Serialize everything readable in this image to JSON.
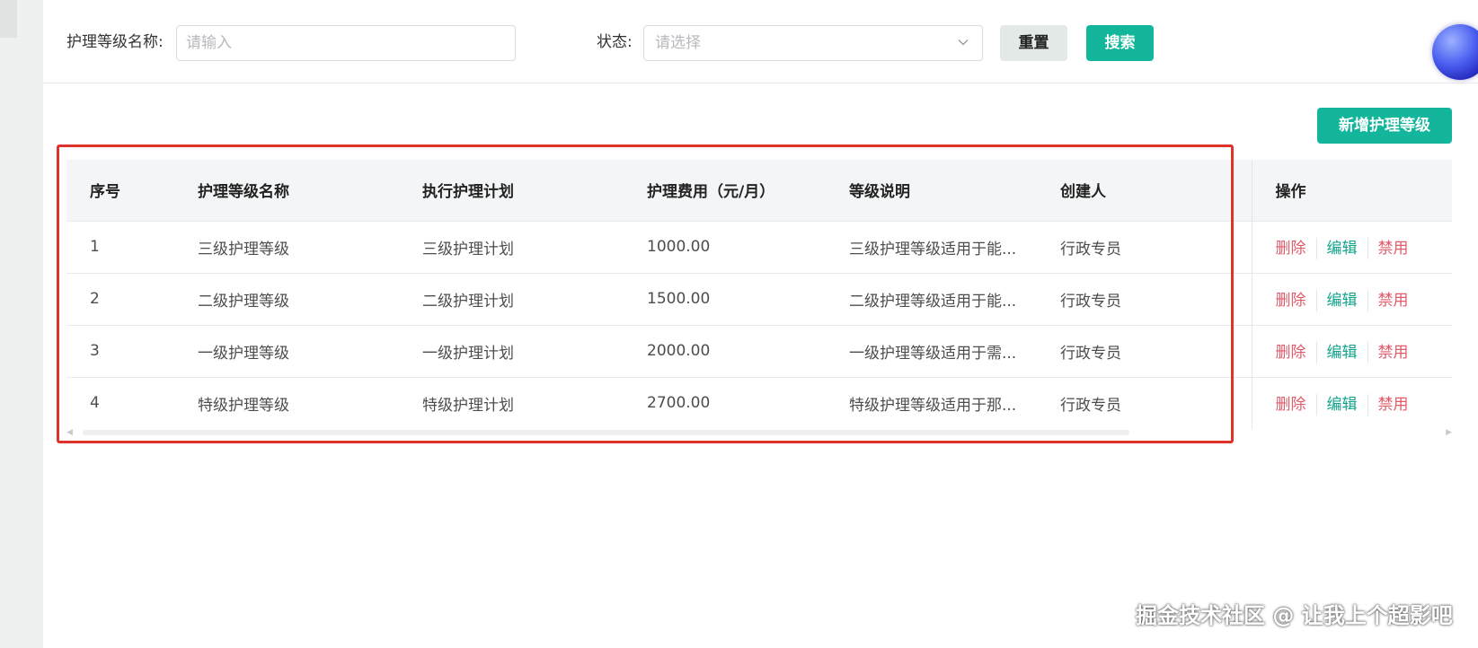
{
  "filter": {
    "name_label": "护理等级名称:",
    "name_placeholder": "请输入",
    "status_label": "状态:",
    "status_placeholder": "请选择",
    "reset_label": "重置",
    "search_label": "搜索"
  },
  "toolbar": {
    "add_label": "新增护理等级"
  },
  "table": {
    "columns": [
      "序号",
      "护理等级名称",
      "执行护理计划",
      "护理费用（元/月）",
      "等级说明",
      "创建人",
      "操作"
    ],
    "rows": [
      {
        "index": "1",
        "name": "三级护理等级",
        "plan": "三级护理计划",
        "fee": "1000.00",
        "desc": "三级护理等级适用于能...",
        "creator": "行政专员"
      },
      {
        "index": "2",
        "name": "二级护理等级",
        "plan": "二级护理计划",
        "fee": "1500.00",
        "desc": "二级护理等级适用于能...",
        "creator": "行政专员"
      },
      {
        "index": "3",
        "name": "一级护理等级",
        "plan": "一级护理计划",
        "fee": "2000.00",
        "desc": "一级护理等级适用于需...",
        "creator": "行政专员"
      },
      {
        "index": "4",
        "name": "特级护理等级",
        "plan": "特级护理计划",
        "fee": "2700.00",
        "desc": "特级护理等级适用于那...",
        "creator": "行政专员"
      }
    ],
    "actions": {
      "delete": "删除",
      "edit": "编辑",
      "disable": "禁用"
    }
  },
  "colors": {
    "accent": "#13b69a",
    "danger": "#e05a69",
    "highlight": "#e0312b"
  },
  "watermark": "掘金技术社区 @ 让我上个超影吧"
}
